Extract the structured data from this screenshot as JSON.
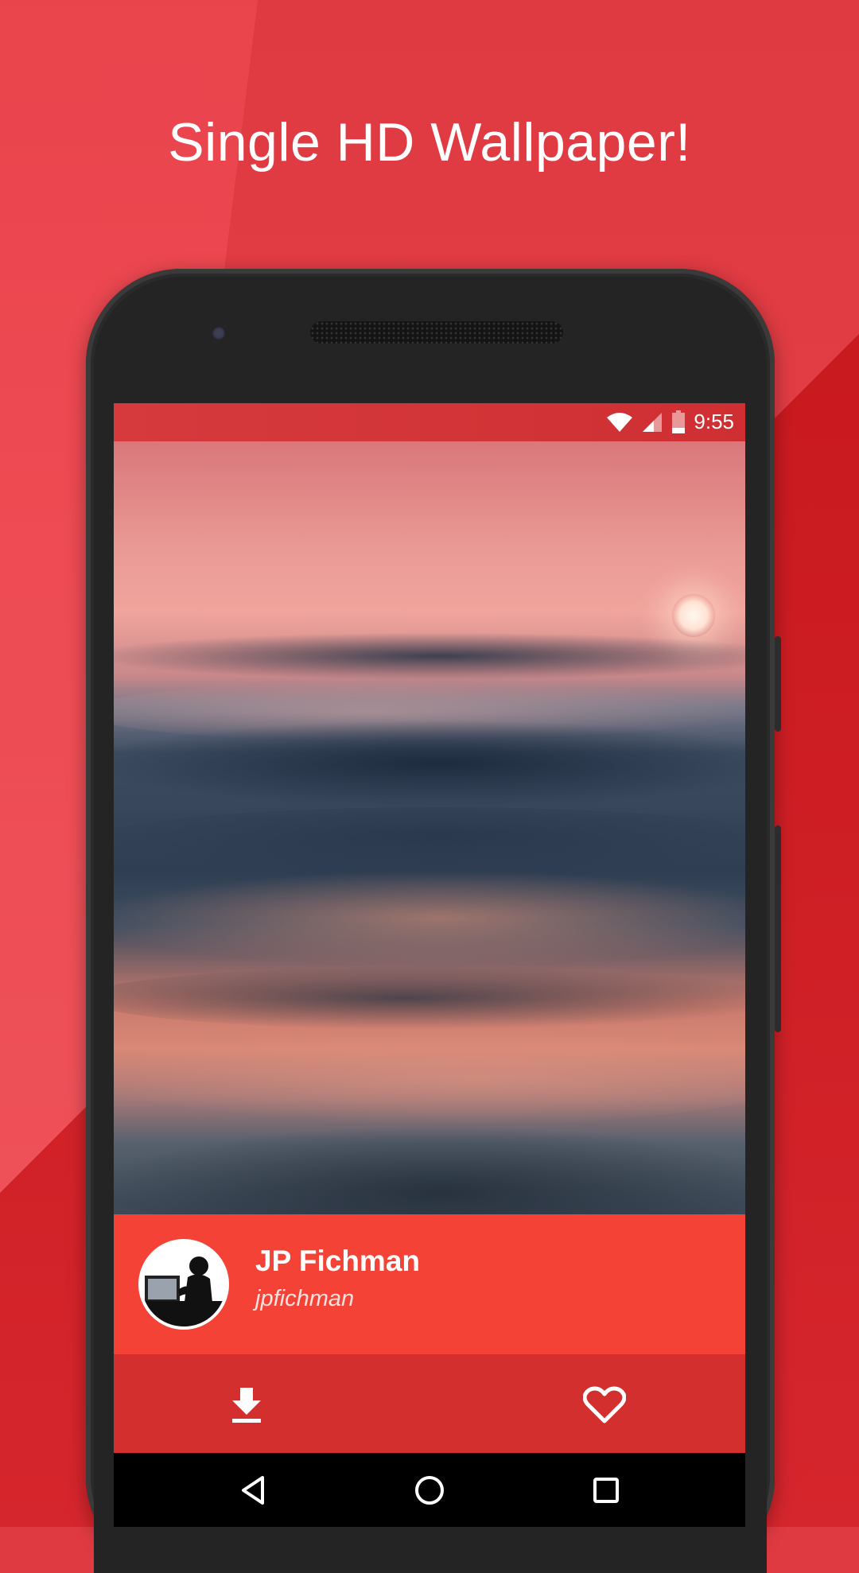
{
  "promo": {
    "headline": "Single HD Wallpaper!"
  },
  "status_bar": {
    "time": "9:55",
    "icons": [
      "wifi-icon",
      "cell-signal-icon",
      "battery-icon"
    ]
  },
  "wallpaper": {
    "subject": "sunset-over-ocean-waves"
  },
  "creator": {
    "name": "JP Fichman",
    "username": "jpfichman"
  },
  "actions": {
    "download_icon": "download-icon",
    "favorite_icon": "heart-outline-icon"
  },
  "nav_bar": {
    "buttons": [
      "back-icon",
      "home-icon",
      "recents-icon"
    ]
  },
  "colors": {
    "background": "#df3a42",
    "creator_bar": "#f44336",
    "action_bar": "#d32f2f",
    "status_bar": "#d63a3d"
  }
}
